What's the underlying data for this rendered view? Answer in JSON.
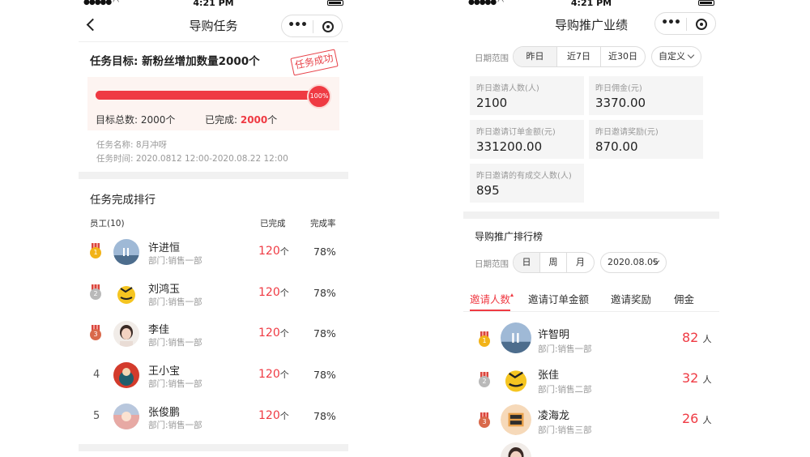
{
  "left": {
    "status_time": "4:21 PM",
    "nav_title": "导购任务",
    "goal_title": "任务目标: 新粉丝增加数量2000个",
    "stamp": "任务成功",
    "progress": {
      "percent": 100,
      "label": "100%"
    },
    "target_total_label": "目标总数: ",
    "target_total_value": "2000个",
    "completed_label": "已完成: ",
    "completed_value": "2000",
    "completed_unit": "个",
    "task_name": "任务名称: 8月冲呀",
    "task_time": "任务时间: 2020.0812 12:00-2020.08.22 12:00",
    "ranking_title": "任务完成排行",
    "columns": {
      "employee": "员工(10)",
      "done": "已完成",
      "rate": "完成率"
    },
    "unit": "个",
    "rows": [
      {
        "rank": "1",
        "medal": "gold",
        "name": "许进恒",
        "dept": "部门:销售一部",
        "done": "120",
        "rate": "78%"
      },
      {
        "rank": "2",
        "medal": "silver",
        "name": "刘鸿玉",
        "dept": "部门:销售一部",
        "done": "120",
        "rate": "78%"
      },
      {
        "rank": "3",
        "medal": "bronze",
        "name": "李佳",
        "dept": "部门:销售一部",
        "done": "120",
        "rate": "78%"
      },
      {
        "rank": "4",
        "medal": "",
        "name": "王小宝",
        "dept": "部门:销售一部",
        "done": "120",
        "rate": "78%"
      },
      {
        "rank": "5",
        "medal": "",
        "name": "张俊鹏",
        "dept": "部门:销售一部",
        "done": "120",
        "rate": "78%"
      }
    ]
  },
  "right": {
    "status_time": "4:21 PM",
    "nav_title": "导购推广业绩",
    "date_range_label": "日期范围",
    "date_options": [
      "昨日",
      "近7日",
      "近30日"
    ],
    "date_custom": "自定义",
    "kpis": [
      {
        "label": "昨日邀请人数(人)",
        "value": "2100"
      },
      {
        "label": "昨日佣金(元)",
        "value": "3370.00"
      },
      {
        "label": "昨日邀请订单金额(元)",
        "value": "331200.00"
      },
      {
        "label": "昨日邀请奖励(元)",
        "value": "870.00"
      },
      {
        "label": "昨日邀请的有成交人数(人)",
        "value": "895"
      }
    ],
    "ranking_title": "导购推广排行榜",
    "range_label": "日期范围",
    "range_options": [
      "日",
      "周",
      "月"
    ],
    "range_date": "2020.08.05",
    "tabs": [
      "邀请人数",
      "邀请订单金额",
      "邀请奖励",
      "佣金"
    ],
    "unit": "人",
    "rows": [
      {
        "rank": "1",
        "medal": "gold",
        "name": "许智明",
        "dept": "部门:销售一部",
        "value": "82"
      },
      {
        "rank": "2",
        "medal": "silver",
        "name": "张佳",
        "dept": "部门:销售二部",
        "value": "32"
      },
      {
        "rank": "3",
        "medal": "bronze",
        "name": "凌海龙",
        "dept": "部门:销售三部",
        "value": "26"
      }
    ]
  },
  "colors": {
    "accent": "#ef3a43",
    "gold": "#f2b318",
    "silver": "#b9b9b9",
    "bronze": "#d9694b"
  }
}
